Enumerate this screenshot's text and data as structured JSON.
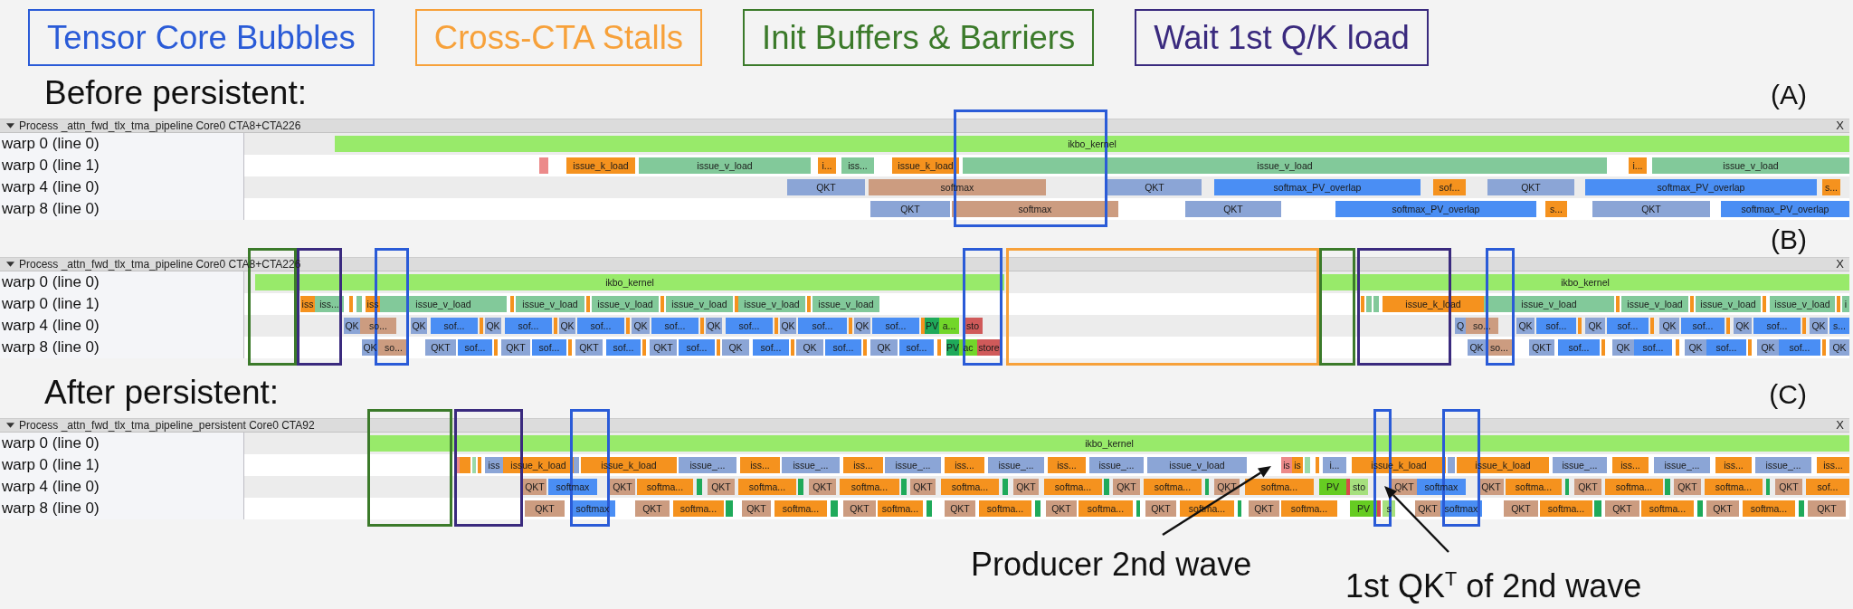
{
  "legend": [
    {
      "label": "Tensor Core Bubbles",
      "color": "#2a5bd7"
    },
    {
      "label": "Cross-CTA Stalls",
      "color": "#f7a13a"
    },
    {
      "label": "Init Buffers & Barriers",
      "color": "#3b7a2a"
    },
    {
      "label": "Wait 1st Q/K load",
      "color": "#3a2a7e"
    }
  ],
  "sections": [
    {
      "heading": "Before persistent:",
      "panels": [
        {
          "tag": "(A)",
          "process": {
            "title": "Process _attn_fwd_tlx_tma_pipeline Core0 CTA8+CTA226",
            "expanded": true,
            "close": "X"
          },
          "tracks": [
            {
              "label": "warp 0 (line 0)",
              "slices": [
                {
                  "label": "ikbo_kernel",
                  "color": "#98ea6a"
                }
              ]
            },
            {
              "label": "warp 0 (line 1)",
              "slices": [
                {
                  "color": "#ec8a8a"
                },
                {
                  "label": "issue_k_load",
                  "color": "#f5921e"
                },
                {
                  "label": "issue_v_load",
                  "color": "#82c99a"
                },
                {
                  "label": "i...",
                  "color": "#f5921e"
                },
                {
                  "label": "iss...",
                  "color": "#82c99a"
                },
                {
                  "label": "issue_k_load",
                  "color": "#f5921e"
                },
                {
                  "label": "issue_v_load",
                  "color": "#82c99a"
                },
                {
                  "label": "i...",
                  "color": "#f5921e"
                },
                {
                  "label": "issue_v_load",
                  "color": "#82c99a"
                }
              ]
            },
            {
              "label": "warp 4 (line 0)",
              "slices": [
                {
                  "label": "QKT",
                  "color": "#8ba5d6"
                },
                {
                  "label": "softmax",
                  "color": "#cc9c80"
                },
                {
                  "label": "QKT",
                  "color": "#8ba5d6"
                },
                {
                  "label": "softmax_PV_overlap",
                  "color": "#4a8ef4"
                },
                {
                  "label": "sof...",
                  "color": "#f5921e"
                },
                {
                  "label": "QKT",
                  "color": "#8ba5d6"
                },
                {
                  "label": "softmax_PV_overlap",
                  "color": "#4a8ef4"
                },
                {
                  "label": "s...",
                  "color": "#f5921e"
                }
              ]
            },
            {
              "label": "warp 8 (line 0)",
              "slices": [
                {
                  "label": "QKT",
                  "color": "#8ba5d6"
                },
                {
                  "label": "softmax",
                  "color": "#cc9c80"
                },
                {
                  "label": "QKT",
                  "color": "#8ba5d6"
                },
                {
                  "label": "softmax_PV_overlap",
                  "color": "#4a8ef4"
                },
                {
                  "label": "s...",
                  "color": "#f5921e"
                },
                {
                  "label": "QKT",
                  "color": "#8ba5d6"
                },
                {
                  "label": "softmax_PV_overlap",
                  "color": "#4a8ef4"
                }
              ]
            }
          ],
          "highlights": [
            {
              "color": "#2a5bd7"
            }
          ]
        },
        {
          "tag": "(B)",
          "process": {
            "title": "Process _attn_fwd_tlx_tma_pipeline Core0 CTA8+CTA226",
            "expanded": true,
            "close": "X"
          },
          "tracks": [
            {
              "label": "warp 0 (line 0)",
              "slices": [
                {
                  "label": "ikbo_kernel",
                  "color": "#98ea6a"
                },
                {
                  "label": "ikbo_kernel",
                  "color": "#98ea6a"
                }
              ]
            },
            {
              "label": "warp 0 (line 1)",
              "slices": [
                {
                  "label": "iss",
                  "color": "#f5921e"
                },
                {
                  "label": "iss...",
                  "color": "#82c99a"
                },
                {
                  "color": "#f5921e"
                },
                {
                  "color": "#82c99a"
                },
                {
                  "label": "iss",
                  "color": "#f5921e"
                },
                {
                  "label": "issue_v_load",
                  "color": "#82c99a"
                },
                {
                  "color": "#f5921e"
                },
                {
                  "label": "issue_v_load",
                  "color": "#82c99a"
                },
                {
                  "color": "#f5921e"
                },
                {
                  "label": "issue_v_load",
                  "color": "#82c99a"
                },
                {
                  "color": "#f5921e"
                },
                {
                  "label": "issue_v_load",
                  "color": "#82c99a"
                },
                {
                  "color": "#f5921e"
                },
                {
                  "label": "issue_v_load",
                  "color": "#82c99a"
                },
                {
                  "color": "#f5921e"
                },
                {
                  "label": "issue_v_load",
                  "color": "#82c99a"
                },
                {
                  "color": "#f5921e"
                },
                {
                  "color": "#82c99a"
                },
                {
                  "color": "#82c99a"
                },
                {
                  "label": "issue_k_load",
                  "color": "#f5921e"
                },
                {
                  "label": "issue_v_load",
                  "color": "#82c99a"
                },
                {
                  "color": "#f5921e"
                },
                {
                  "label": "issue_v_load",
                  "color": "#82c99a"
                },
                {
                  "color": "#f5921e"
                },
                {
                  "label": "issue_v_load",
                  "color": "#82c99a"
                },
                {
                  "color": "#f5921e"
                },
                {
                  "label": "issue_v_load",
                  "color": "#82c99a"
                },
                {
                  "color": "#f5921e"
                },
                {
                  "label": "i",
                  "color": "#82c99a"
                }
              ]
            },
            {
              "label": "warp 4 (line 0)",
              "slices": [
                {
                  "label": "QK",
                  "color": "#8ba5d6"
                },
                {
                  "label": "so...",
                  "color": "#cc9c80"
                },
                {
                  "label": "QK",
                  "color": "#8ba5d6"
                },
                {
                  "label": "sof...",
                  "color": "#4a8ef4"
                },
                {
                  "color": "#f5921e"
                },
                {
                  "label": "QK",
                  "color": "#8ba5d6"
                },
                {
                  "label": "sof...",
                  "color": "#4a8ef4"
                },
                {
                  "color": "#f5921e"
                },
                {
                  "label": "QK",
                  "color": "#8ba5d6"
                },
                {
                  "label": "sof...",
                  "color": "#4a8ef4"
                },
                {
                  "color": "#f5921e"
                },
                {
                  "label": "QK",
                  "color": "#8ba5d6"
                },
                {
                  "label": "sof...",
                  "color": "#4a8ef4"
                },
                {
                  "color": "#f5921e"
                },
                {
                  "label": "QK",
                  "color": "#8ba5d6"
                },
                {
                  "label": "sof...",
                  "color": "#4a8ef4"
                },
                {
                  "color": "#f5921e"
                },
                {
                  "label": "QK",
                  "color": "#8ba5d6"
                },
                {
                  "label": "sof...",
                  "color": "#4a8ef4"
                },
                {
                  "color": "#f5921e"
                },
                {
                  "label": "QK",
                  "color": "#8ba5d6"
                },
                {
                  "label": "sof...",
                  "color": "#4a8ef4"
                },
                {
                  "color": "#f5921e"
                },
                {
                  "label": "PV",
                  "color": "#1faa5a"
                },
                {
                  "label": "a...",
                  "color": "#72d62a"
                },
                {
                  "label": "sto",
                  "color": "#d05a5a"
                },
                {
                  "label": "Q",
                  "color": "#8ba5d6"
                },
                {
                  "label": "so...",
                  "color": "#cc9c80"
                },
                {
                  "label": "QK",
                  "color": "#8ba5d6"
                },
                {
                  "label": "sof...",
                  "color": "#4a8ef4"
                },
                {
                  "color": "#f5921e"
                },
                {
                  "label": "QK",
                  "color": "#8ba5d6"
                },
                {
                  "label": "sof...",
                  "color": "#4a8ef4"
                },
                {
                  "color": "#f5921e"
                },
                {
                  "label": "QK",
                  "color": "#8ba5d6"
                },
                {
                  "label": "sof...",
                  "color": "#4a8ef4"
                },
                {
                  "color": "#f5921e"
                },
                {
                  "label": "QK",
                  "color": "#8ba5d6"
                },
                {
                  "label": "sof...",
                  "color": "#4a8ef4"
                },
                {
                  "color": "#f5921e"
                },
                {
                  "label": "QK",
                  "color": "#8ba5d6"
                },
                {
                  "label": "s...",
                  "color": "#4a8ef4"
                }
              ]
            },
            {
              "label": "warp 8 (line 0)",
              "slices": [
                {
                  "label": "QK",
                  "color": "#8ba5d6"
                },
                {
                  "label": "so...",
                  "color": "#cc9c80"
                },
                {
                  "label": "QKT",
                  "color": "#8ba5d6"
                },
                {
                  "label": "sof...",
                  "color": "#4a8ef4"
                },
                {
                  "color": "#f5921e"
                },
                {
                  "label": "QKT",
                  "color": "#8ba5d6"
                },
                {
                  "label": "sof...",
                  "color": "#4a8ef4"
                },
                {
                  "color": "#f5921e"
                },
                {
                  "label": "QKT",
                  "color": "#8ba5d6"
                },
                {
                  "label": "sof...",
                  "color": "#4a8ef4"
                },
                {
                  "color": "#f5921e"
                },
                {
                  "label": "QKT",
                  "color": "#8ba5d6"
                },
                {
                  "label": "sof...",
                  "color": "#4a8ef4"
                },
                {
                  "color": "#f5921e"
                },
                {
                  "label": "QK",
                  "color": "#8ba5d6"
                },
                {
                  "label": "sof...",
                  "color": "#4a8ef4"
                },
                {
                  "color": "#f5921e"
                },
                {
                  "label": "QK",
                  "color": "#8ba5d6"
                },
                {
                  "label": "sof...",
                  "color": "#4a8ef4"
                },
                {
                  "color": "#f5921e"
                },
                {
                  "label": "QK",
                  "color": "#8ba5d6"
                },
                {
                  "label": "sof...",
                  "color": "#4a8ef4"
                },
                {
                  "color": "#f5921e"
                },
                {
                  "label": "PV",
                  "color": "#1faa5a"
                },
                {
                  "label": "ac",
                  "color": "#72d62a"
                },
                {
                  "label": "store",
                  "color": "#d05a5a"
                },
                {
                  "label": "QK",
                  "color": "#8ba5d6"
                },
                {
                  "label": "so...",
                  "color": "#cc9c80"
                },
                {
                  "label": "QKT",
                  "color": "#8ba5d6"
                },
                {
                  "label": "sof...",
                  "color": "#4a8ef4"
                },
                {
                  "color": "#f5921e"
                },
                {
                  "label": "QK",
                  "color": "#8ba5d6"
                },
                {
                  "label": "sof...",
                  "color": "#4a8ef4"
                },
                {
                  "color": "#f5921e"
                },
                {
                  "label": "QK",
                  "color": "#8ba5d6"
                },
                {
                  "label": "sof...",
                  "color": "#4a8ef4"
                },
                {
                  "color": "#f5921e"
                },
                {
                  "label": "QK",
                  "color": "#8ba5d6"
                },
                {
                  "label": "sof...",
                  "color": "#4a8ef4"
                },
                {
                  "color": "#f5921e"
                },
                {
                  "label": "QK",
                  "color": "#8ba5d6"
                }
              ]
            }
          ],
          "highlights": [
            {
              "color": "#3b7a2a"
            },
            {
              "color": "#3a2a7e"
            },
            {
              "color": "#2a5bd7"
            },
            {
              "color": "#2a5bd7"
            },
            {
              "color": "#f7a13a"
            },
            {
              "color": "#3b7a2a"
            },
            {
              "color": "#3a2a7e"
            },
            {
              "color": "#2a5bd7"
            }
          ]
        }
      ]
    },
    {
      "heading": "After persistent:",
      "panels": [
        {
          "tag": "(C)",
          "process": {
            "title": "Process _attn_fwd_tlx_tma_pipeline_persistent Core0 CTA92",
            "expanded": true,
            "close": "X"
          },
          "tracks": [
            {
              "label": "warp 0 (line 0)",
              "slices": [
                {
                  "label": "ikbo_kernel",
                  "color": "#98ea6a"
                }
              ]
            },
            {
              "label": "warp 0 (line 1)",
              "slices": [
                {
                  "color": "#ec8a8a"
                },
                {
                  "color": "#f5921e"
                },
                {
                  "color": "#9ad9a8"
                },
                {
                  "color": "#f5921e"
                },
                {
                  "label": "iss",
                  "color": "#8ba5d6"
                },
                {
                  "label": "issue_k_load",
                  "color": "#f5921e"
                },
                {
                  "color": "#8ba5d6"
                },
                {
                  "label": "issue_k_load",
                  "color": "#f5921e"
                },
                {
                  "label": "issue_...",
                  "color": "#8ba5d6"
                },
                {
                  "label": "iss...",
                  "color": "#f5921e"
                },
                {
                  "label": "issue_...",
                  "color": "#8ba5d6"
                },
                {
                  "label": "iss...",
                  "color": "#f5921e"
                },
                {
                  "label": "issue_...",
                  "color": "#8ba5d6"
                },
                {
                  "label": "iss...",
                  "color": "#f5921e"
                },
                {
                  "label": "issue_...",
                  "color": "#8ba5d6"
                },
                {
                  "label": "iss...",
                  "color": "#f5921e"
                },
                {
                  "label": "issue_...",
                  "color": "#8ba5d6"
                },
                {
                  "label": "issue_v_load",
                  "color": "#8ba5d6"
                },
                {
                  "label": "is",
                  "color": "#ec8a8a"
                },
                {
                  "label": "is",
                  "color": "#f5921e"
                },
                {
                  "color": "#9ad9a8"
                },
                {
                  "color": "#f5921e"
                },
                {
                  "label": "i...",
                  "color": "#8ba5d6"
                },
                {
                  "label": "issue_k_load",
                  "color": "#f5921e"
                },
                {
                  "color": "#8ba5d6"
                },
                {
                  "label": "issue_k_load",
                  "color": "#f5921e"
                },
                {
                  "label": "issue_...",
                  "color": "#8ba5d6"
                },
                {
                  "label": "iss...",
                  "color": "#f5921e"
                },
                {
                  "label": "issue_...",
                  "color": "#8ba5d6"
                },
                {
                  "label": "iss...",
                  "color": "#f5921e"
                },
                {
                  "label": "issue_...",
                  "color": "#8ba5d6"
                },
                {
                  "label": "iss...",
                  "color": "#f5921e"
                }
              ]
            },
            {
              "label": "warp 4 (line 0)",
              "slices": [
                {
                  "label": "QKT",
                  "color": "#cc9c80"
                },
                {
                  "label": "softmax",
                  "color": "#4a8ef4"
                },
                {
                  "label": "QKT",
                  "color": "#cc9c80"
                },
                {
                  "label": "softma...",
                  "color": "#f5921e"
                },
                {
                  "color": "#1faa5a"
                },
                {
                  "label": "QKT",
                  "color": "#cc9c80"
                },
                {
                  "label": "softma...",
                  "color": "#f5921e"
                },
                {
                  "color": "#1faa5a"
                },
                {
                  "label": "QKT",
                  "color": "#cc9c80"
                },
                {
                  "label": "softma...",
                  "color": "#f5921e"
                },
                {
                  "color": "#1faa5a"
                },
                {
                  "label": "QKT",
                  "color": "#cc9c80"
                },
                {
                  "label": "softma...",
                  "color": "#f5921e"
                },
                {
                  "color": "#1faa5a"
                },
                {
                  "label": "QKT",
                  "color": "#cc9c80"
                },
                {
                  "label": "softma...",
                  "color": "#f5921e"
                },
                {
                  "color": "#1faa5a"
                },
                {
                  "label": "QKT",
                  "color": "#cc9c80"
                },
                {
                  "label": "softma...",
                  "color": "#f5921e"
                },
                {
                  "color": "#1faa5a"
                },
                {
                  "label": "QKT",
                  "color": "#cc9c80"
                },
                {
                  "label": "softma...",
                  "color": "#f5921e"
                },
                {
                  "label": "PV",
                  "color": "#66cc22"
                },
                {
                  "color": "#d84a4a"
                },
                {
                  "label": "sto",
                  "color": "#a6e07e"
                },
                {
                  "label": "QKT",
                  "color": "#cc9c80"
                },
                {
                  "label": "softmax",
                  "color": "#4a8ef4"
                },
                {
                  "label": "QKT",
                  "color": "#cc9c80"
                },
                {
                  "label": "softma...",
                  "color": "#f5921e"
                },
                {
                  "color": "#1faa5a"
                },
                {
                  "label": "QKT",
                  "color": "#cc9c80"
                },
                {
                  "label": "softma...",
                  "color": "#f5921e"
                },
                {
                  "color": "#1faa5a"
                },
                {
                  "label": "QKT",
                  "color": "#cc9c80"
                },
                {
                  "label": "softma...",
                  "color": "#f5921e"
                },
                {
                  "color": "#1faa5a"
                },
                {
                  "label": "QKT",
                  "color": "#cc9c80"
                },
                {
                  "label": "sof...",
                  "color": "#f5921e"
                }
              ]
            },
            {
              "label": "warp 8 (line 0)",
              "slices": [
                {
                  "label": "QKT",
                  "color": "#cc9c80"
                },
                {
                  "label": "softmax",
                  "color": "#4a8ef4"
                },
                {
                  "label": "QKT",
                  "color": "#cc9c80"
                },
                {
                  "label": "softma...",
                  "color": "#f5921e"
                },
                {
                  "color": "#1faa5a"
                },
                {
                  "label": "QKT",
                  "color": "#cc9c80"
                },
                {
                  "label": "softma...",
                  "color": "#f5921e"
                },
                {
                  "color": "#1faa5a"
                },
                {
                  "label": "QKT",
                  "color": "#cc9c80"
                },
                {
                  "label": "softma...",
                  "color": "#f5921e"
                },
                {
                  "color": "#1faa5a"
                },
                {
                  "label": "QKT",
                  "color": "#cc9c80"
                },
                {
                  "label": "softma...",
                  "color": "#f5921e"
                },
                {
                  "color": "#1faa5a"
                },
                {
                  "label": "QKT",
                  "color": "#cc9c80"
                },
                {
                  "label": "softma...",
                  "color": "#f5921e"
                },
                {
                  "color": "#1faa5a"
                },
                {
                  "label": "QKT",
                  "color": "#cc9c80"
                },
                {
                  "label": "softma...",
                  "color": "#f5921e"
                },
                {
                  "color": "#1faa5a"
                },
                {
                  "label": "QKT",
                  "color": "#cc9c80"
                },
                {
                  "label": "softma...",
                  "color": "#f5921e"
                },
                {
                  "label": "PV",
                  "color": "#66cc22"
                },
                {
                  "color": "#d84a4a"
                },
                {
                  "label": "s",
                  "color": "#a6e07e"
                },
                {
                  "label": "QKT",
                  "color": "#cc9c80"
                },
                {
                  "label": "softmax",
                  "color": "#4a8ef4"
                },
                {
                  "label": "QKT",
                  "color": "#cc9c80"
                },
                {
                  "label": "softma...",
                  "color": "#f5921e"
                },
                {
                  "color": "#1faa5a"
                },
                {
                  "label": "QKT",
                  "color": "#cc9c80"
                },
                {
                  "label": "softma...",
                  "color": "#f5921e"
                },
                {
                  "color": "#1faa5a"
                },
                {
                  "label": "QKT",
                  "color": "#cc9c80"
                },
                {
                  "label": "softma...",
                  "color": "#f5921e"
                },
                {
                  "color": "#1faa5a"
                },
                {
                  "label": "QKT",
                  "color": "#cc9c80"
                }
              ]
            }
          ],
          "highlights": [
            {
              "color": "#3b7a2a"
            },
            {
              "color": "#3a2a7e"
            },
            {
              "color": "#2a5bd7"
            },
            {
              "color": "#2a5bd7"
            },
            {
              "color": "#2a5bd7"
            }
          ]
        }
      ],
      "callouts": [
        {
          "text": "Producer 2nd wave"
        },
        {
          "text": "1st QK$^{T}$ of 2nd wave"
        }
      ]
    }
  ]
}
